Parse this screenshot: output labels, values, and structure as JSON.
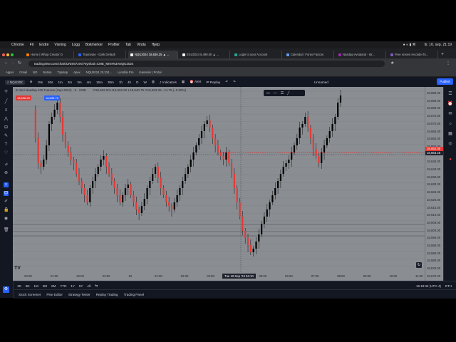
{
  "mac_menu": {
    "items": [
      "Chrome",
      "Fil",
      "Endre",
      "Visning",
      "Logg",
      "Bokmerker",
      "Profiler",
      "Tab",
      "Vindu",
      "Hjelp"
    ],
    "clock": "tir. 10. sep. 21:19"
  },
  "browser": {
    "tabs": [
      {
        "label": "Home | Whop Creator D",
        "active": false,
        "color": "#f57c00"
      },
      {
        "label": "Tradovate - Dark Default",
        "active": false,
        "color": "#2962ff"
      },
      {
        "label": "NQU2024 18,636.25 ▲ ...",
        "active": true,
        "color": "#ffffff"
      },
      {
        "label": "ESU2024 5,498.00 ▲ ...",
        "active": false,
        "color": "#ffffff"
      },
      {
        "label": "Login to your Account",
        "active": false,
        "color": "#26a69a"
      },
      {
        "label": "Calendar | Forex Factory",
        "active": false,
        "color": "#5d9cec"
      },
      {
        "label": "Nasdaq-Avsatand - str...",
        "active": false,
        "color": "#9c27b0"
      },
      {
        "label": "Free screen recorder fo...",
        "active": false,
        "color": "#7e57c2"
      }
    ],
    "url": "tradingview.com/chart/IJNm67zev/?symbol=CME_MINI%3ANQU2024",
    "bookmarks": [
      "Apper",
      "Gmail",
      "NO",
      "Notion",
      "Topstep",
      "Apex",
      "NQU2024 20,234...",
      "Loonbla Pro",
      "Kalender | Portal"
    ]
  },
  "toolbar": {
    "symbol": "NQU202",
    "intervals": [
      "15s",
      "30s",
      "1m",
      "2m",
      "3m",
      "4m",
      "15m",
      "30m",
      "1h",
      "4h",
      "D",
      "W"
    ],
    "indicators_label": "Indicators",
    "alert_label": "Alert",
    "replay_label": "Replay",
    "layout_label": "Unnamed",
    "publish_label": "Publish"
  },
  "legend": {
    "title": "E-mini Nasdaq-100 Futures (Sep 2024) · 5 · CME",
    "ohlc": "O18,662.50 H18,662.50 L18,640.75 C18,653.25 −11.75 (−0.06%)",
    "sell_label": "18,636.25",
    "buy_label": "18,636.75"
  },
  "price_axis": {
    "labels": [
      "18,690.00",
      "18,685.00",
      "18,680.00",
      "18,675.00",
      "18,670.00",
      "18,665.00",
      "18,660.00",
      "18,655.00",
      "18,650.00",
      "18,645.00",
      "18,640.00",
      "18,635.00",
      "18,630.00",
      "18,625.00",
      "18,620.00",
      "18,615.00",
      "18,610.00",
      "18,605.00",
      "18,600.00",
      "18,595.00",
      "18,590.00",
      "18,585.00",
      "18,580.00",
      "18,575.00",
      "18,570.00"
    ],
    "current_price": "18,652.00",
    "cursor_price": "18,653.25"
  },
  "time_axis": {
    "labels": [
      "20:00",
      "21:00",
      "22:00",
      "23:00",
      "10",
      "01:00",
      "02:00",
      "03:00",
      "04:00",
      "05:00",
      "06:00",
      "07:00",
      "08:00",
      "09:00",
      "10:00",
      "11:00"
    ],
    "cursor_time": "Tue 10 Sep '24  04:10"
  },
  "range_bar": {
    "ranges": [
      "1D",
      "5D",
      "1M",
      "3M",
      "6M",
      "YTD",
      "1Y",
      "5Y",
      "All"
    ],
    "clock": "15:18:32 (UTC-4)",
    "session": "ETH"
  },
  "bottom_tabs": [
    "Stock Screener",
    "Pine Editor",
    "Strategy Tester",
    "Replay Trading",
    "Trading Panel"
  ],
  "colors": {
    "chart_bg": "#8a8d92",
    "up_candle": "#000000",
    "down_candle": "#e53935",
    "accent": "#2962ff",
    "price_line": "#e53935"
  },
  "icons": {
    "logo": "tradingview-logo-icon"
  }
}
